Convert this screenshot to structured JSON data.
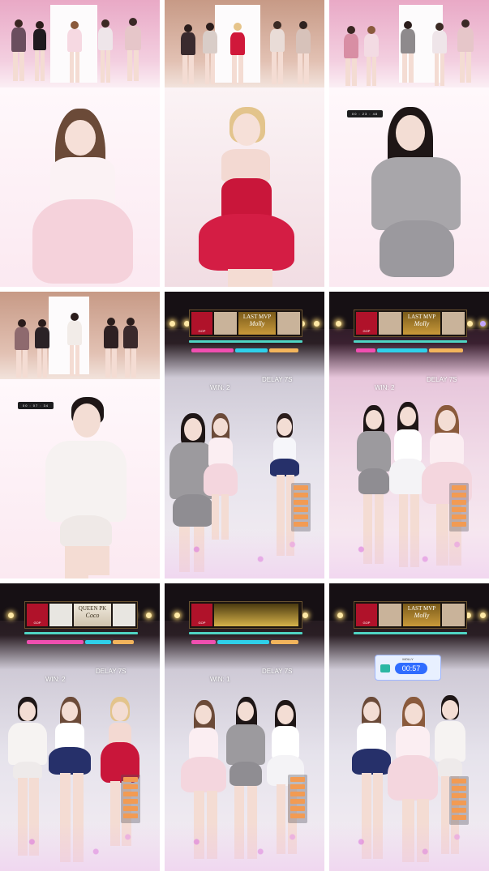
{
  "timestamps": {
    "panel_3": "00 : 23 : 48",
    "panel_4": "00 : 07 : 34"
  },
  "streams": [
    {
      "banner_top": "LAST MVP",
      "banner_name": "Molly",
      "badge": "GOP",
      "delay": "DELAY 7S",
      "win": "WIN: 2"
    },
    {
      "banner_top": "LAST MVP",
      "banner_name": "Molly",
      "badge": "GOP",
      "delay": "DELAY 7S",
      "win": "WIN: 2"
    },
    {
      "banner_top": "QUEEN PK",
      "banner_name": "Coco",
      "badge": "GOP",
      "delay": "DELAY 7S",
      "win": "WIN: 2"
    },
    {
      "banner_top": "",
      "banner_name": "",
      "badge": "GOP",
      "delay": "DELAY 7S",
      "win": "WIN: 1"
    },
    {
      "banner_top": "LAST MVP",
      "banner_name": "Molly",
      "badge": "GOP",
      "timer_title": "MOLLY",
      "timer": "00:57"
    }
  ],
  "colors": {
    "bar_pink": "#f04fb0",
    "bar_cyan": "#2fd0ea",
    "bar_orange": "#f2b45c",
    "accent_gold": "#c99a3a"
  }
}
